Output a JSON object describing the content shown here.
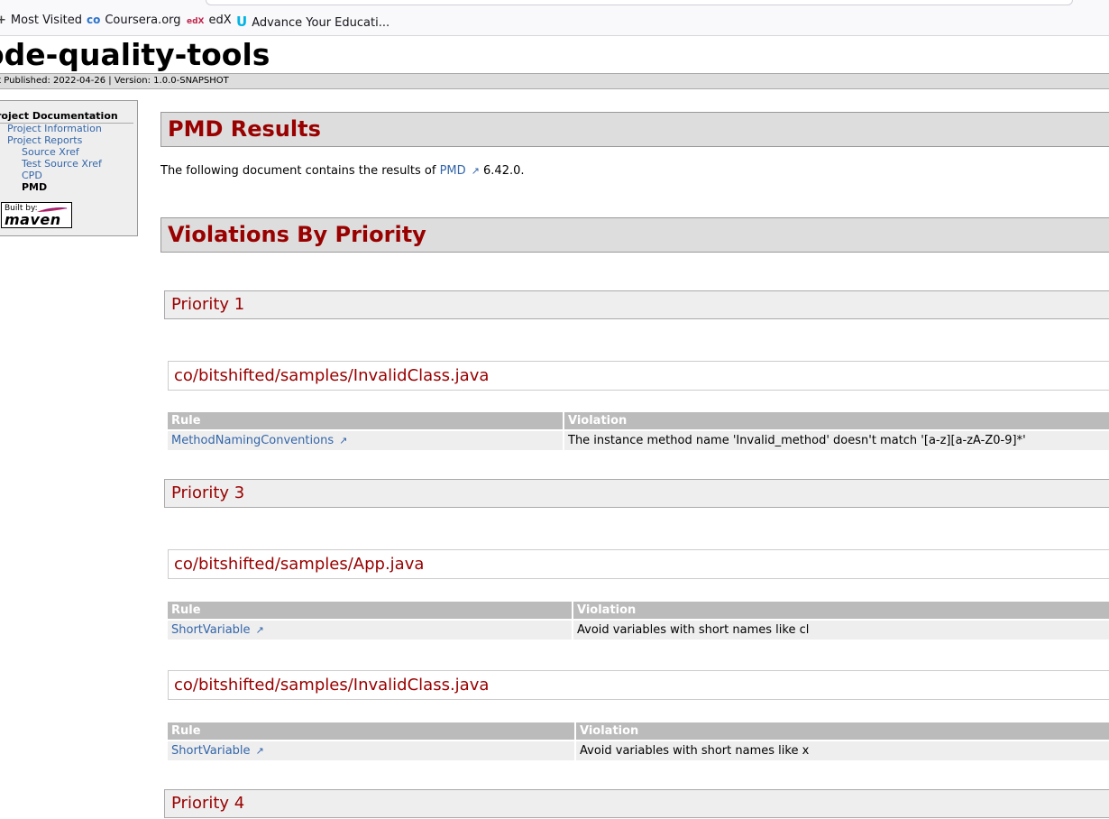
{
  "bookmarks": [
    {
      "icon": "+",
      "label": "Most Visited"
    },
    {
      "icon": "co",
      "label": "Coursera.org"
    },
    {
      "icon": "edX",
      "label": "edX"
    },
    {
      "icon": "U",
      "label": "Advance Your Educati..."
    }
  ],
  "banner": {
    "title": "ode-quality-tools",
    "breadcrumb": "st Published: 2022-04-26  | Version: 1.0.0-SNAPSHOT"
  },
  "nav": {
    "heading": "roject Documentation",
    "items": [
      "Project Information",
      "Project Reports",
      "Source Xref",
      "Test Source Xref",
      "CPD",
      "PMD"
    ],
    "built_by_label": "Built by:",
    "built_by_name": "maven"
  },
  "main": {
    "title": "PMD Results",
    "intro_before": "The following document contains the results of ",
    "intro_link": "PMD",
    "intro_after": " 6.42.0.",
    "section_title": "Violations By Priority",
    "col_rule": "Rule",
    "col_violation": "Violation",
    "priorities": [
      {
        "title": "Priority 1",
        "files": [
          {
            "name": "co/bitshifted/samples/InvalidClass.java",
            "rule": "MethodNamingConventions",
            "violation": "The instance method name 'Invalid_method' doesn't match '[a-z][a-zA-Z0-9]*'"
          }
        ]
      },
      {
        "title": "Priority 3",
        "files": [
          {
            "name": "co/bitshifted/samples/App.java",
            "rule": "ShortVariable",
            "violation": "Avoid variables with short names like cl"
          },
          {
            "name": "co/bitshifted/samples/InvalidClass.java",
            "rule": "ShortVariable",
            "violation": "Avoid variables with short names like x"
          }
        ]
      },
      {
        "title": "Priority 4",
        "files": []
      }
    ]
  },
  "colors": {
    "heading": "#990000",
    "link": "#3366aa",
    "table_header": "#bbbbbb"
  },
  "icons": {
    "external_link": "external-link-icon"
  }
}
